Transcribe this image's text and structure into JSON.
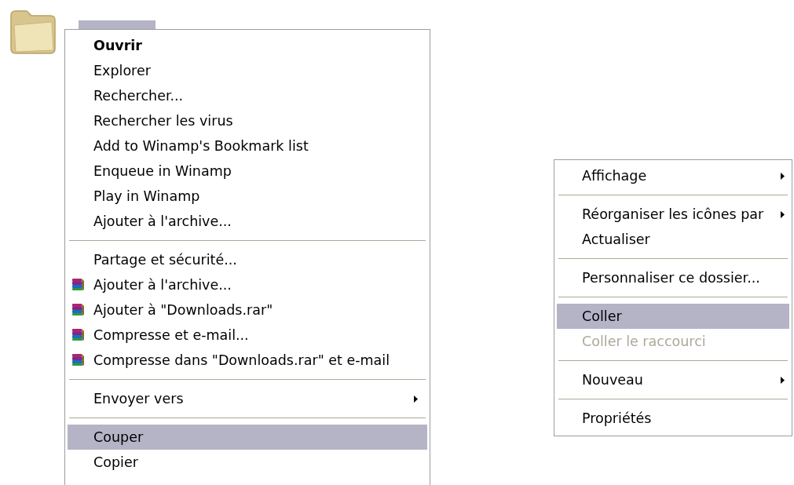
{
  "desktop_icon": {
    "kind": "folder",
    "selected": true
  },
  "file_menu": {
    "items": [
      {
        "kind": "item",
        "label": "Ouvrir",
        "default": true,
        "selected": false
      },
      {
        "kind": "item",
        "label": "Explorer",
        "selected": false
      },
      {
        "kind": "item",
        "label": "Rechercher...",
        "selected": false
      },
      {
        "kind": "item",
        "label": "Rechercher les virus",
        "selected": false
      },
      {
        "kind": "item",
        "label": "Add to Winamp's Bookmark list",
        "selected": false
      },
      {
        "kind": "item",
        "label": "Enqueue in Winamp",
        "selected": false
      },
      {
        "kind": "item",
        "label": "Play in Winamp",
        "selected": false
      },
      {
        "kind": "item",
        "label": "Ajouter à l'archive...",
        "selected": false
      },
      {
        "kind": "separator"
      },
      {
        "kind": "item",
        "label": "Partage et sécurité...",
        "selected": false
      },
      {
        "kind": "archive-item",
        "label": "Ajouter à l'archive...",
        "selected": false
      },
      {
        "kind": "archive-item",
        "label": "Ajouter à \"Downloads.rar\"",
        "selected": false
      },
      {
        "kind": "archive-item",
        "label": "Compresse et e-mail...",
        "selected": false
      },
      {
        "kind": "archive-item",
        "label": "Compresse dans \"Downloads.rar\" et e-mail",
        "selected": false
      },
      {
        "kind": "separator"
      },
      {
        "kind": "item",
        "label": "Envoyer vers",
        "submenu": true,
        "selected": false
      },
      {
        "kind": "separator"
      },
      {
        "kind": "item",
        "label": "Couper",
        "selected": true
      },
      {
        "kind": "item",
        "label": "Copier",
        "selected": false
      }
    ]
  },
  "background_menu": {
    "items": [
      {
        "kind": "item",
        "label": "Affichage",
        "submenu": true,
        "selected": false
      },
      {
        "kind": "separator"
      },
      {
        "kind": "item",
        "label": "Réorganiser les icônes par",
        "submenu": true,
        "selected": false
      },
      {
        "kind": "item",
        "label": "Actualiser",
        "selected": false
      },
      {
        "kind": "separator"
      },
      {
        "kind": "item",
        "label": "Personnaliser ce dossier...",
        "selected": false
      },
      {
        "kind": "separator"
      },
      {
        "kind": "item",
        "label": "Coller",
        "selected": true
      },
      {
        "kind": "item",
        "label": "Coller le raccourci",
        "disabled": true,
        "selected": false
      },
      {
        "kind": "separator"
      },
      {
        "kind": "item",
        "label": "Nouveau",
        "submenu": true,
        "selected": false
      },
      {
        "kind": "separator"
      },
      {
        "kind": "item",
        "label": "Propriétés",
        "selected": false
      }
    ]
  }
}
